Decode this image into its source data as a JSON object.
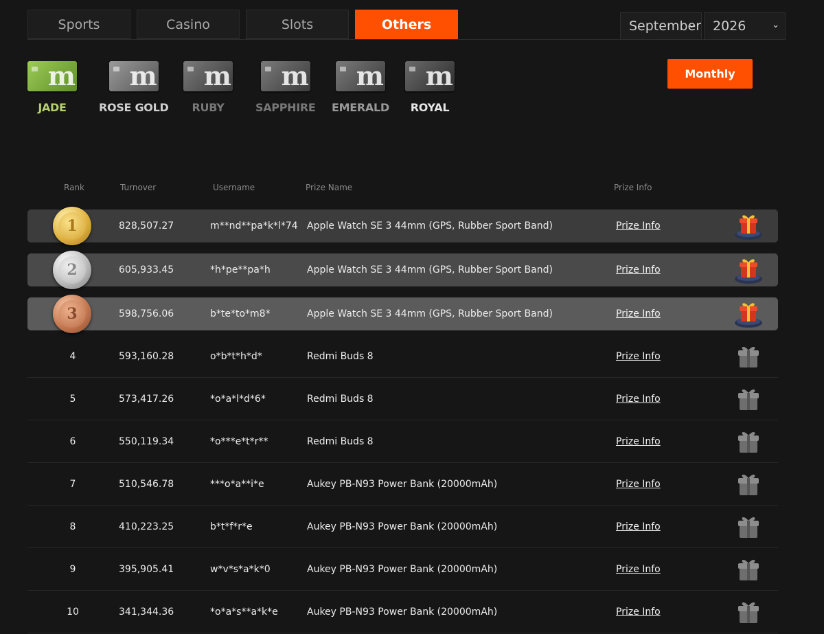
{
  "tabs": [
    {
      "label": "Sports"
    },
    {
      "label": "Casino"
    },
    {
      "label": "Slots"
    },
    {
      "label": "Others",
      "active": true
    }
  ],
  "filters": {
    "month": "September",
    "year": "2026"
  },
  "tiers": [
    {
      "label": "JADE"
    },
    {
      "label": "ROSE GOLD"
    },
    {
      "label": "RUBY"
    },
    {
      "label": "SAPPHIRE"
    },
    {
      "label": "EMERALD"
    },
    {
      "label": "ROYAL"
    }
  ],
  "period_button": "Monthly",
  "table": {
    "headers": {
      "rank": "Rank",
      "turnover": "Turnover",
      "username": "Username",
      "prize_name": "Prize Name",
      "prize_info": "Prize Info"
    },
    "rows": [
      {
        "rank": "1",
        "turnover": "828,507.27",
        "username": "m**nd**pa*k*l*74",
        "prize": "Apple Watch SE 3 44mm (GPS, Rubber Sport Band)",
        "info": "Prize Info"
      },
      {
        "rank": "2",
        "turnover": "605,933.45",
        "username": "*h*pe**pa*h",
        "prize": "Apple Watch SE 3 44mm (GPS, Rubber Sport Band)",
        "info": "Prize Info"
      },
      {
        "rank": "3",
        "turnover": "598,756.06",
        "username": "b*te*to*m8*",
        "prize": "Apple Watch SE 3 44mm (GPS, Rubber Sport Band)",
        "info": "Prize Info"
      },
      {
        "rank": "4",
        "turnover": "593,160.28",
        "username": "o*b*t*h*d*",
        "prize": "Redmi Buds 8",
        "info": "Prize Info"
      },
      {
        "rank": "5",
        "turnover": "573,417.26",
        "username": "*o*a*l*d*6*",
        "prize": "Redmi Buds 8",
        "info": "Prize Info"
      },
      {
        "rank": "6",
        "turnover": "550,119.34",
        "username": "*o***e*t*r**",
        "prize": "Redmi Buds 8",
        "info": "Prize Info"
      },
      {
        "rank": "7",
        "turnover": "510,546.78",
        "username": "***o*a**i*e",
        "prize": "Aukey PB-N93 Power Bank (20000mAh)",
        "info": "Prize Info"
      },
      {
        "rank": "8",
        "turnover": "410,223.25",
        "username": "b*t*f*r*e",
        "prize": "Aukey PB-N93 Power Bank (20000mAh)",
        "info": "Prize Info"
      },
      {
        "rank": "9",
        "turnover": "395,905.41",
        "username": "w*v*s*a*k*0",
        "prize": "Aukey PB-N93 Power Bank (20000mAh)",
        "info": "Prize Info"
      },
      {
        "rank": "10",
        "turnover": "341,344.36",
        "username": "*o*a*s**a*k*e",
        "prize": "Aukey PB-N93 Power Bank (20000mAh)",
        "info": "Prize Info"
      }
    ]
  },
  "colors": {
    "accent": "#fe5000",
    "background": "#161616",
    "jade": "#b5cf6e"
  }
}
